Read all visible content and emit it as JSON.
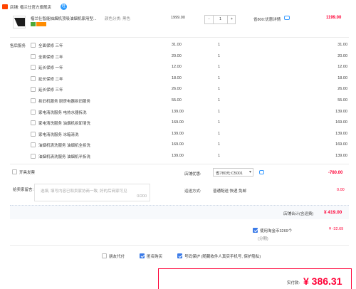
{
  "store": {
    "label": "店铺: 楷兰仕官方旗舰店",
    "badge": "旺"
  },
  "product": {
    "title": "楷兰仕智能抽烟机顶吸油烟机家用型...",
    "spec": "颜色分类: 黑色",
    "price": "1999.00",
    "quantity": "1",
    "discount_label": "省800:优惠详情",
    "subtotal": "1199.00",
    "minus": "−",
    "plus": "+"
  },
  "service_section_label": "售后服务",
  "services": [
    {
      "label": "全面保修 三年",
      "price": "31.00",
      "qty": "1",
      "total": "31.00"
    },
    {
      "label": "全面保修 二年",
      "price": "20.00",
      "qty": "1",
      "total": "20.00"
    },
    {
      "label": "延长保修 一年",
      "price": "12.00",
      "qty": "1",
      "total": "12.00"
    },
    {
      "label": "延长保修 二年",
      "price": "18.00",
      "qty": "1",
      "total": "18.00"
    },
    {
      "label": "延长保修 三年",
      "price": "26.00",
      "qty": "1",
      "total": "26.00"
    },
    {
      "label": "拆旧机服务 厨房电器拆旧服务",
      "price": "55.00",
      "qty": "1",
      "total": "55.00"
    },
    {
      "label": "家电清洗服务 电热水器拆洗",
      "price": "139.00",
      "qty": "1",
      "total": "139.00"
    },
    {
      "label": "家电清洗服务 油烟机拆卸清洗",
      "price": "169.00",
      "qty": "1",
      "total": "169.00"
    },
    {
      "label": "家电清洗服务 冰箱清洗",
      "price": "139.00",
      "qty": "1",
      "total": "139.00"
    },
    {
      "label": "油烟机清洗服务 油烟机全拆洗",
      "price": "169.00",
      "qty": "1",
      "total": "169.00"
    },
    {
      "label": "油烟机清洗服务 油烟机半拆洗",
      "price": "139.00",
      "qty": "1",
      "total": "139.00"
    }
  ],
  "invoice": {
    "label": "开具发票"
  },
  "coupon": {
    "label": "店铺优惠:",
    "value": "省780元:C5001",
    "amount": "-780.00"
  },
  "message": {
    "label": "给卖家留言:",
    "placeholder": "选填, 填写内容已和卖家协商一致, 好的后商家可见",
    "counter": "0/200"
  },
  "delivery": {
    "label": "运送方式:",
    "value": "普通配送 快递 免邮",
    "amount": "0.00"
  },
  "store_total": {
    "label": "店铺合计(含运费)",
    "amount": "¥ 419.00"
  },
  "taojinbi": {
    "label": "使用淘金币3269个",
    "amount": "¥ -32.69",
    "note": "(分期)"
  },
  "options": [
    {
      "label": "朋友代付",
      "checked": false
    },
    {
      "label": "匿名购买",
      "checked": true
    },
    {
      "label": "号码保护 (随藏收件人真实手机号, 保护隐私)",
      "checked": true
    }
  ],
  "payment": {
    "label": "实付款:",
    "amount": "¥ 386.31"
  },
  "colors": {
    "accent": "#ff0036",
    "checkbox": "#3b7be8"
  }
}
